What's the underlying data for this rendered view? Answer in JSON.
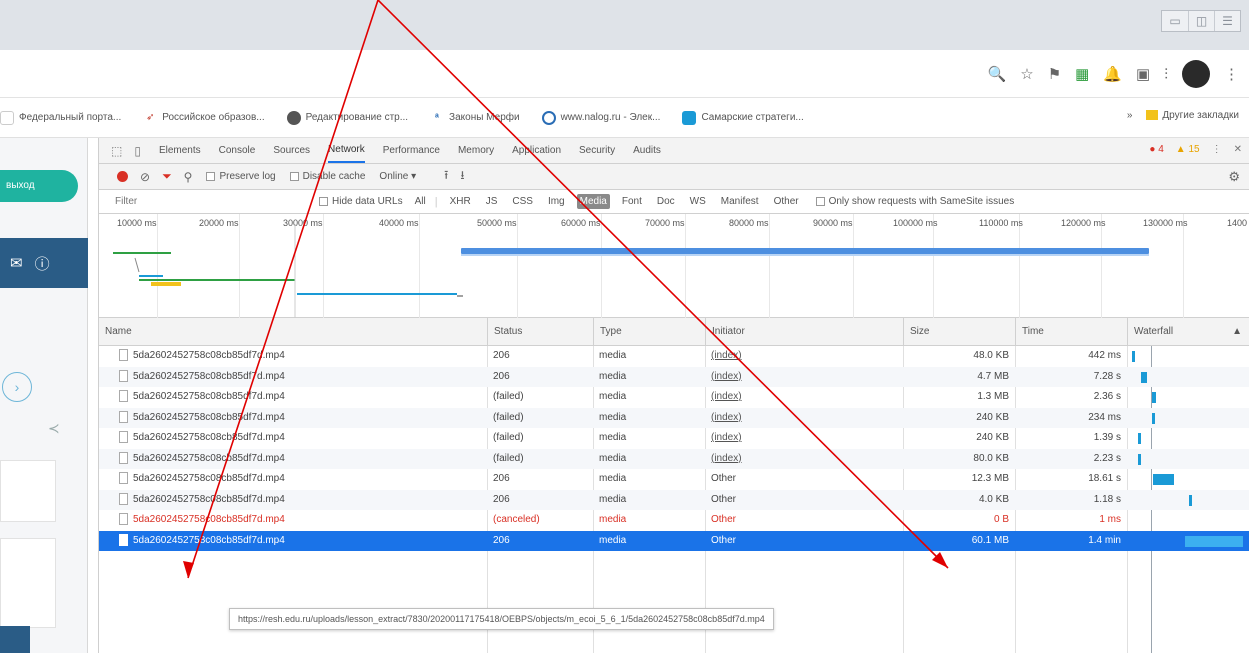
{
  "window_controls": [
    "▭",
    "◫",
    "☰"
  ],
  "toolbar_icons": {
    "zoom": "🔍",
    "star": "☆",
    "ext1": "⚑",
    "ext2": "▦",
    "bell": "🔔",
    "ext3": "▣",
    "menu_ext": "⫶",
    "more": "⋮"
  },
  "bookmarks": [
    {
      "label": "Федеральный порта...",
      "icon_color": "#ffffff"
    },
    {
      "label": "Российское образов...",
      "icon_color": "#c0392b"
    },
    {
      "label": "Редактирование стр...",
      "icon_color": "#555555"
    },
    {
      "label": "Законы Мерфи",
      "icon_color": "#2a6db5"
    },
    {
      "label": "www.nalog.ru - Элек...",
      "icon_color": "#2a6db5"
    },
    {
      "label": "Самарские стратеги...",
      "icon_color": "#1a9ad6"
    }
  ],
  "bookmarks_more": "»",
  "bookmarks_other": "Другие закладки",
  "page_left": {
    "exit_label": "выход",
    "nav_icons": [
      "mail-icon",
      "help-icon"
    ]
  },
  "devtools": {
    "tabs": [
      "Elements",
      "Console",
      "Sources",
      "Network",
      "Performance",
      "Memory",
      "Application",
      "Security",
      "Audits"
    ],
    "active_tab": "Network",
    "errors": "4",
    "warnings": "15",
    "toolbar": {
      "preserve_log": "Preserve log",
      "disable_cache": "Disable cache",
      "throttle": "Online"
    },
    "filter": {
      "placeholder": "Filter",
      "hide_data_urls": "Hide data URLs",
      "types": [
        "All",
        "XHR",
        "JS",
        "CSS",
        "Img",
        "Media",
        "Font",
        "Doc",
        "WS",
        "Manifest",
        "Other"
      ],
      "active_type": "Media",
      "same_site": "Only show requests with SameSite issues"
    },
    "overview_ticks": [
      "10000 ms",
      "20000 ms",
      "30000 ms",
      "40000 ms",
      "50000 ms",
      "60000 ms",
      "70000 ms",
      "80000 ms",
      "90000 ms",
      "100000 ms",
      "110000 ms",
      "120000 ms",
      "130000 ms",
      "1400"
    ],
    "columns": [
      "Name",
      "Status",
      "Type",
      "Initiator",
      "Size",
      "Time",
      "Waterfall"
    ],
    "rows": [
      {
        "name": "5da2602452758c08cb85df7d.mp4",
        "status": "206",
        "type": "media",
        "initiator": "(index)",
        "initiator_link": true,
        "size": "48.0 KB",
        "time": "442 ms",
        "w_start": 0.01,
        "w_len": 0.02,
        "state": "normal"
      },
      {
        "name": "5da2602452758c08cb85df7d.mp4",
        "status": "206",
        "type": "media",
        "initiator": "(index)",
        "initiator_link": true,
        "size": "4.7 MB",
        "time": "7.28 s",
        "w_start": 0.09,
        "w_len": 0.05,
        "state": "normal"
      },
      {
        "name": "5da2602452758c08cb85df7d.mp4",
        "status": "(failed)",
        "type": "media",
        "initiator": "(index)",
        "initiator_link": true,
        "size": "1.3 MB",
        "time": "2.36 s",
        "w_start": 0.19,
        "w_len": 0.03,
        "state": "normal"
      },
      {
        "name": "5da2602452758c08cb85df7d.mp4",
        "status": "(failed)",
        "type": "media",
        "initiator": "(index)",
        "initiator_link": true,
        "size": "240 KB",
        "time": "234 ms",
        "w_start": 0.19,
        "w_len": 0.02,
        "state": "normal"
      },
      {
        "name": "5da2602452758c08cb85df7d.mp4",
        "status": "(failed)",
        "type": "media",
        "initiator": "(index)",
        "initiator_link": true,
        "size": "240 KB",
        "time": "1.39 s",
        "w_start": 0.06,
        "w_len": 0.02,
        "state": "normal"
      },
      {
        "name": "5da2602452758c08cb85df7d.mp4",
        "status": "(failed)",
        "type": "media",
        "initiator": "(index)",
        "initiator_link": true,
        "size": "80.0 KB",
        "time": "2.23 s",
        "w_start": 0.06,
        "w_len": 0.02,
        "state": "normal"
      },
      {
        "name": "5da2602452758c08cb85df7d.mp4",
        "status": "206",
        "type": "media",
        "initiator": "Other",
        "initiator_link": false,
        "size": "12.3 MB",
        "time": "18.61 s",
        "w_start": 0.2,
        "w_len": 0.18,
        "state": "normal"
      },
      {
        "name": "5da2602452758c08cb85df7d.mp4",
        "status": "206",
        "type": "media",
        "initiator": "Other",
        "initiator_link": false,
        "size": "4.0 KB",
        "time": "1.18 s",
        "w_start": 0.52,
        "w_len": 0.02,
        "state": "normal"
      },
      {
        "name": "5da2602452758c08cb85df7d.mp4",
        "status": "(canceled)",
        "type": "media",
        "initiator": "Other",
        "initiator_link": false,
        "size": "0 B",
        "time": "1 ms",
        "w_start": 0.0,
        "w_len": 0.0,
        "state": "canceled"
      },
      {
        "name": "5da2602452758c08cb85df7d.mp4",
        "status": "206",
        "type": "media",
        "initiator": "Other",
        "initiator_link": false,
        "size": "60.1 MB",
        "time": "1.4 min",
        "w_start": 0.48,
        "w_len": 0.52,
        "state": "selected"
      }
    ],
    "tooltip": "https://resh.edu.ru/uploads/lesson_extract/7830/20200117175418/OEBPS/objects/m_ecoi_5_6_1/5da2602452758c08cb85df7d.mp4"
  },
  "annotation_color": "#e00000"
}
